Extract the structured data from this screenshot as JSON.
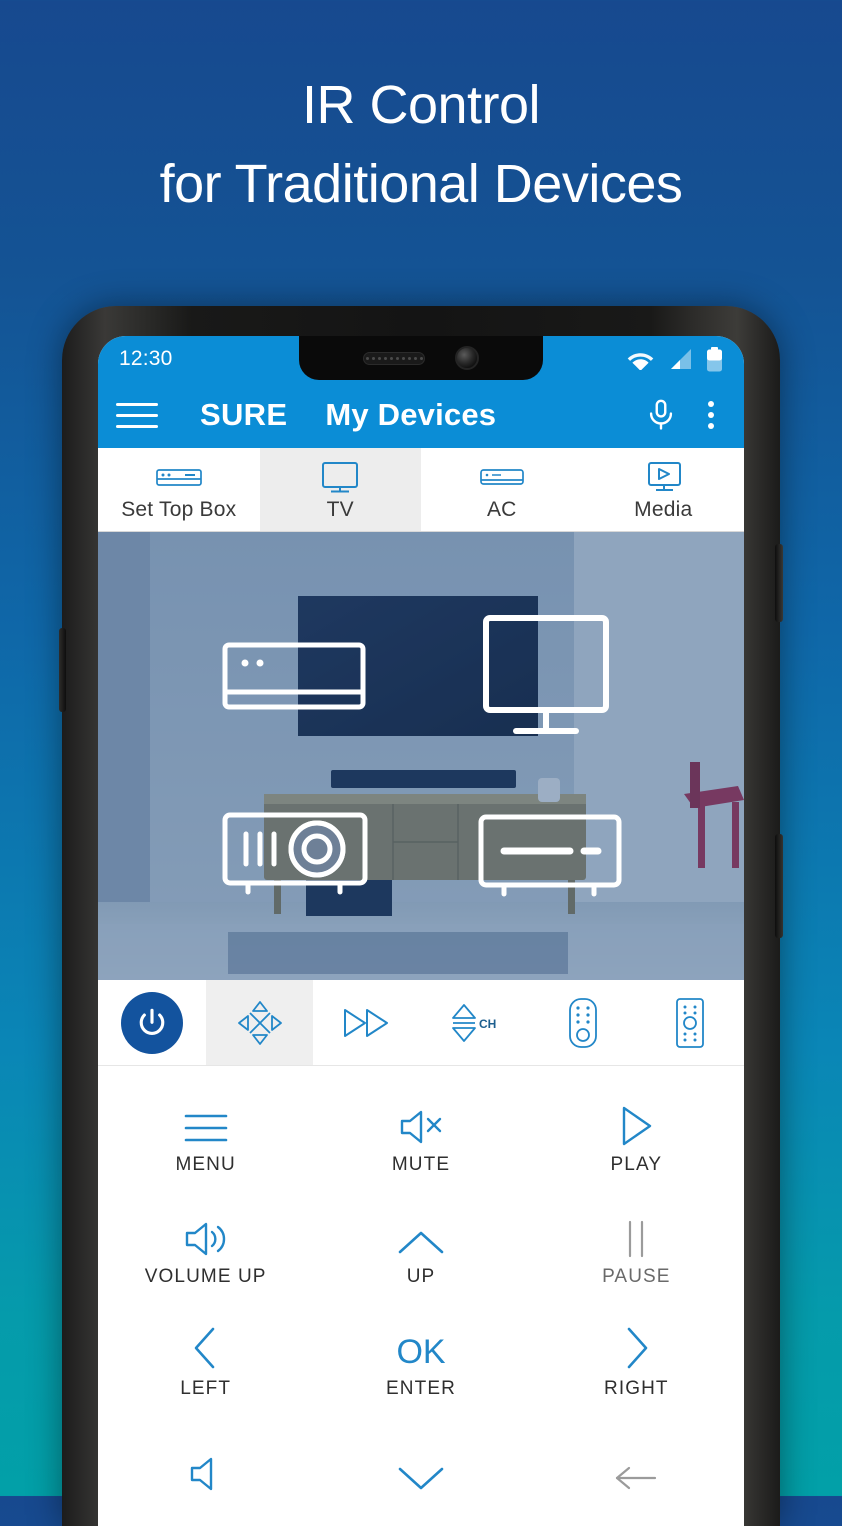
{
  "promo": {
    "line1": "IR Control",
    "line2": "for Traditional Devices"
  },
  "colors": {
    "bg_top": "#17498f",
    "bg_bottom": "#02a0a8",
    "appbar": "#0b8dd6",
    "accent_icon": "#1f86c8",
    "power_button": "#13539e",
    "tab_active_bg": "#ededed",
    "disabled": "#9b9b9b"
  },
  "statusbar": {
    "time": "12:30",
    "icons": [
      "wifi-icon",
      "cellular-signal-icon",
      "battery-icon"
    ]
  },
  "appbar": {
    "menu_icon": "hamburger-menu-icon",
    "brand": "SURE",
    "title": "My Devices",
    "mic_icon": "microphone-icon",
    "overflow_icon": "kebab-menu-icon"
  },
  "tabs": [
    {
      "label": "Set Top Box",
      "icon": "set-top-box-icon",
      "active": false
    },
    {
      "label": "TV",
      "icon": "tv-icon",
      "active": true
    },
    {
      "label": "AC",
      "icon": "air-conditioner-icon",
      "active": false
    },
    {
      "label": "Media",
      "icon": "media-player-icon",
      "active": false
    }
  ],
  "scene": {
    "description": "living-room-photo",
    "devices": [
      {
        "name": "ac-unit-overlay-icon"
      },
      {
        "name": "tv-monitor-overlay-icon"
      },
      {
        "name": "projector-overlay-icon"
      },
      {
        "name": "av-receiver-overlay-icon"
      }
    ]
  },
  "function_toolbar": [
    {
      "name": "power-toggle",
      "icon": "power-icon",
      "selected": false,
      "filled": true
    },
    {
      "name": "navigation-pad",
      "icon": "dpad-icon",
      "selected": true,
      "filled": false
    },
    {
      "name": "playback",
      "icon": "fast-forward-icon",
      "selected": false,
      "filled": false
    },
    {
      "name": "channel",
      "icon": "channel-up-down-icon",
      "label": "CH",
      "selected": false,
      "filled": false
    },
    {
      "name": "remote-keys",
      "icon": "remote-rounded-icon",
      "selected": false,
      "filled": false
    },
    {
      "name": "remote-full",
      "icon": "remote-square-icon",
      "selected": false,
      "filled": false
    }
  ],
  "keys": [
    {
      "label": "MENU",
      "icon": "menu-lines-icon",
      "disabled": false
    },
    {
      "label": "MUTE",
      "icon": "mute-icon",
      "disabled": false
    },
    {
      "label": "PLAY",
      "icon": "play-icon",
      "disabled": false
    },
    {
      "label": "VOLUME UP",
      "icon": "volume-up-icon",
      "disabled": false
    },
    {
      "label": "UP",
      "icon": "chevron-up-icon",
      "disabled": false
    },
    {
      "label": "PAUSE",
      "icon": "pause-icon",
      "disabled": true
    },
    {
      "label": "LEFT",
      "icon": "chevron-left-icon",
      "disabled": false
    },
    {
      "label": "ENTER",
      "icon": "ok-text-icon",
      "disabled": false
    },
    {
      "label": "RIGHT",
      "icon": "chevron-right-icon",
      "disabled": false
    },
    {
      "label": "",
      "icon": "volume-down-icon",
      "disabled": false
    },
    {
      "label": "",
      "icon": "chevron-down-icon",
      "disabled": false
    },
    {
      "label": "",
      "icon": "back-arrow-icon",
      "disabled": true
    }
  ]
}
